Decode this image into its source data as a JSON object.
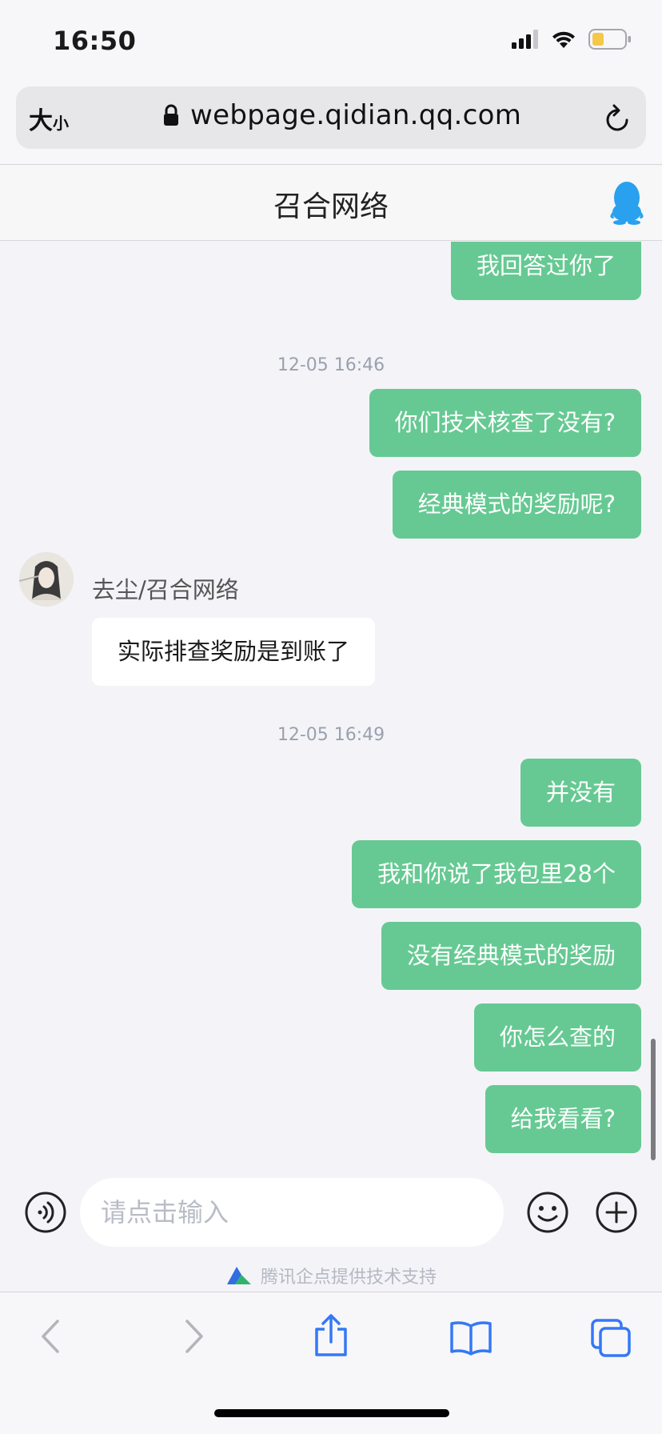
{
  "status_bar": {
    "time": "16:50"
  },
  "address_bar": {
    "aa_large": "大",
    "aa_small": "小",
    "url": "webpage.qidian.qq.com"
  },
  "chat": {
    "title": "召合网络",
    "messages": [
      {
        "type": "me",
        "text": "我回答过你了"
      },
      {
        "type": "time",
        "text": "12-05 16:46"
      },
      {
        "type": "me",
        "text": "你们技术核查了没有?"
      },
      {
        "type": "me",
        "text": "经典模式的奖励呢?"
      },
      {
        "type": "sender",
        "text": "去尘/召合网络"
      },
      {
        "type": "other",
        "text": "实际排查奖励是到账了"
      },
      {
        "type": "time",
        "text": "12-05 16:49"
      },
      {
        "type": "me",
        "text": "并没有"
      },
      {
        "type": "me",
        "text": "我和你说了我包里28个"
      },
      {
        "type": "me",
        "text": "没有经典模式的奖励"
      },
      {
        "type": "me",
        "text": "你怎么查的"
      },
      {
        "type": "me",
        "text": "给我看看?"
      }
    ]
  },
  "input": {
    "placeholder": "请点击输入",
    "powered_by": "腾讯企点提供技术支持"
  },
  "colors": {
    "bubble_me": "#66c993",
    "bubble_other": "#ffffff",
    "background": "#f4f4f8",
    "safari_blue": "#3478f6"
  },
  "icons": [
    "signal-icon",
    "wifi-icon",
    "battery-icon",
    "lock-icon",
    "reload-icon",
    "qq-penguin-icon",
    "voice-icon",
    "emoji-icon",
    "plus-icon",
    "qidian-logo-icon",
    "back-icon",
    "forward-icon",
    "share-icon",
    "bookmarks-icon",
    "tabs-icon"
  ]
}
